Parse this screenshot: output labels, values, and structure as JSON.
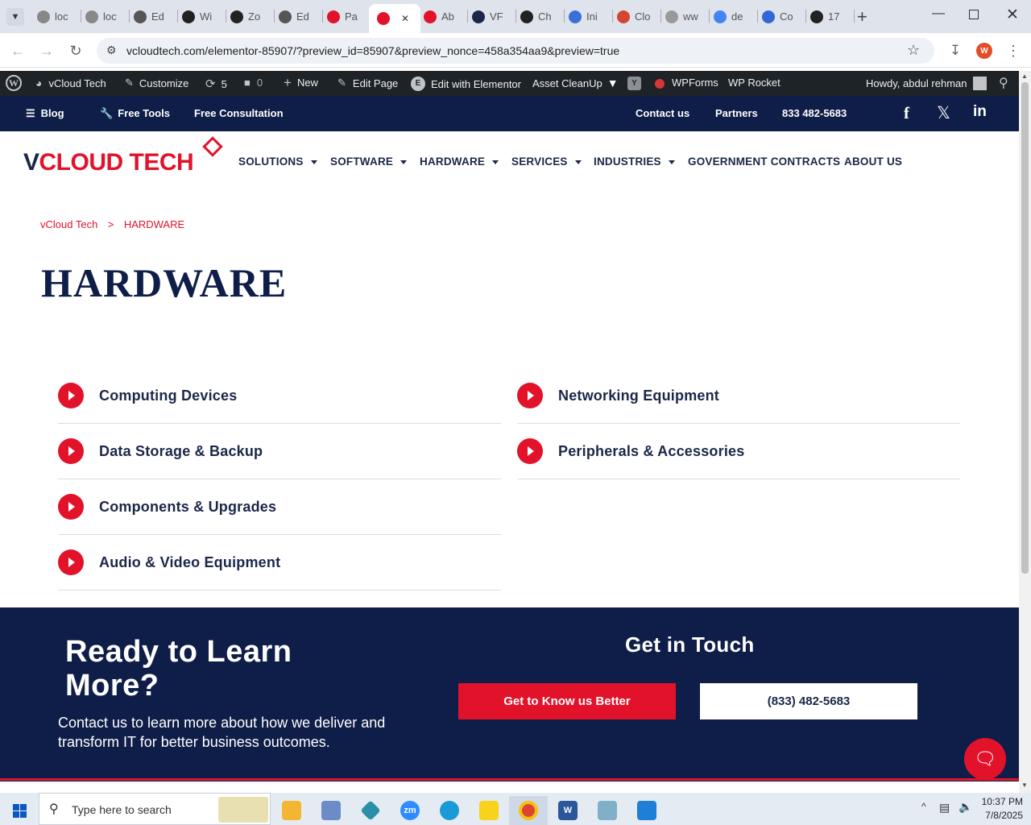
{
  "browser": {
    "tabs": [
      {
        "label": "loc",
        "favicon": "image-icon",
        "color": "#888888"
      },
      {
        "label": "loc",
        "favicon": "image-icon",
        "color": "#888888"
      },
      {
        "label": "Ed",
        "favicon": "globe-icon",
        "color": "#555555"
      },
      {
        "label": "Wi",
        "favicon": "openai-icon",
        "color": "#222222"
      },
      {
        "label": "Zo",
        "favicon": "z-icon",
        "color": "#222222"
      },
      {
        "label": "Ed",
        "favicon": "globe-icon",
        "color": "#555555"
      },
      {
        "label": "Pa",
        "favicon": "vcloud-icon",
        "color": "#e3122b"
      },
      {
        "label": "",
        "favicon": "vcloud-icon",
        "color": "#e3122b",
        "active": true
      },
      {
        "label": "Ab",
        "favicon": "vcloud-icon",
        "color": "#e3122b"
      },
      {
        "label": "VF",
        "favicon": "v-icon",
        "color": "#1c2748"
      },
      {
        "label": "Ch",
        "favicon": "openai-icon",
        "color": "#222222"
      },
      {
        "label": "Ini",
        "favicon": "copilot-icon",
        "color": "#3b6fd8"
      },
      {
        "label": "Clo",
        "favicon": "claude-icon",
        "color": "#d4462f"
      },
      {
        "label": "ww",
        "favicon": "loading-icon",
        "color": "#999999"
      },
      {
        "label": "de",
        "favicon": "google-icon",
        "color": "#4285f4"
      },
      {
        "label": "Co",
        "favicon": "forms-icon",
        "color": "#3367d6"
      },
      {
        "label": "17",
        "favicon": "dollar-icon",
        "color": "#222222"
      }
    ],
    "url": "vcloudtech.com/elementor-85907/?preview_id=85907&preview_nonce=458a354aa9&preview=true",
    "profile_initial": "W"
  },
  "wpbar": {
    "site": "vCloud Tech",
    "customize": "Customize",
    "updates": "5",
    "comments": "0",
    "new": "New",
    "edit_page": "Edit Page",
    "edit_elementor": "Edit with Elementor",
    "asset_cleanup": "Asset CleanUp",
    "wpforms": "WPForms",
    "wprocket": "WP Rocket",
    "howdy": "Howdy, abdul rehman"
  },
  "topnav": {
    "blog": "Blog",
    "free_tools": "Free Tools",
    "free_consultation": "Free Consultation",
    "contact": "Contact us",
    "partners": "Partners",
    "phone": "833 482-5683"
  },
  "logo": {
    "text_v": "V",
    "text_rest": "CLOUD TECH"
  },
  "mainnav": {
    "solutions": "SOLUTIONS",
    "software": "SOFTWARE",
    "hardware": "HARDWARE",
    "services": "SERVICES",
    "industries": "INDUSTRIES",
    "gov": "GOVERNMENT CONTRACTS",
    "about": "ABOUT US"
  },
  "breadcrumb": {
    "home": "vCloud Tech",
    "sep": ">",
    "current": "HARDWARE"
  },
  "page_title": "HARDWARE",
  "categories_left": [
    "Computing Devices",
    "Data Storage & Backup",
    "Components & Upgrades",
    "Audio & Video Equipment"
  ],
  "categories_right": [
    "Networking Equipment",
    "Peripherals & Accessories"
  ],
  "cta": {
    "heading_line1": "Ready to Learn",
    "heading_line2": "More?",
    "body": "Contact us to learn more about how we deliver and transform IT for better business outcomes.",
    "get_in_touch": "Get in Touch",
    "btn_know": "Get to Know us Better",
    "btn_phone": "(833) 482-5683"
  },
  "taskbar": {
    "search_placeholder": "Type here to search",
    "time": "10:37 PM",
    "date": "7/8/2025"
  }
}
